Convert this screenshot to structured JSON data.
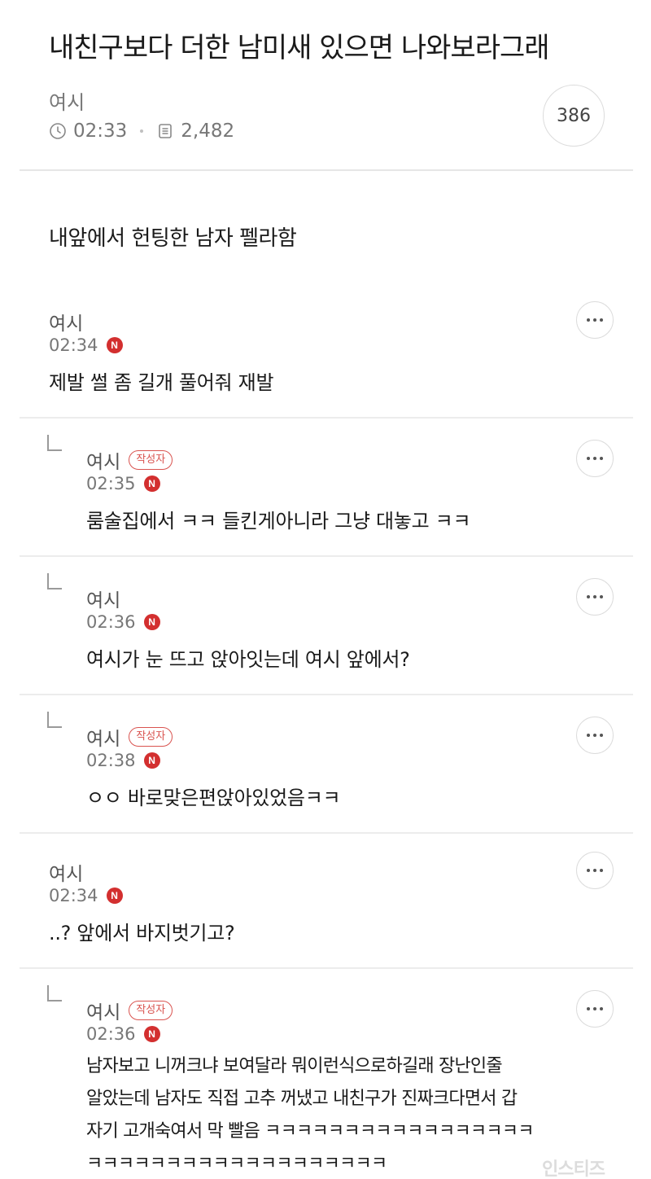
{
  "post": {
    "title": "내친구보다 더한 남미새 있으면 나와보라그래",
    "author": "여시",
    "time": "02:33",
    "views": "2,482",
    "reply_count": "386",
    "body": "내앞에서 헌팅한 남자 펠라함"
  },
  "badges": {
    "new": "N",
    "writer": "작성자"
  },
  "comments": [
    {
      "author": "여시",
      "time": "02:34",
      "text": "제발 썰 좀 길개 풀어줘 재발",
      "is_reply": false,
      "is_writer": false
    },
    {
      "author": "여시",
      "time": "02:35",
      "text": "룸술집에서 ㅋㅋ 들킨게아니라 그냥 대놓고 ㅋㅋ",
      "is_reply": true,
      "is_writer": true
    },
    {
      "author": "여시",
      "time": "02:36",
      "text": "여시가 눈 뜨고 앉아잇는데 여시 앞에서?",
      "is_reply": true,
      "is_writer": false
    },
    {
      "author": "여시",
      "time": "02:38",
      "text": "ㅇㅇ 바로맞은편앉아있었음ㅋㅋ",
      "is_reply": true,
      "is_writer": true
    },
    {
      "author": "여시",
      "time": "02:34",
      "text": "..? 앞에서 바지벗기고?",
      "is_reply": false,
      "is_writer": false
    },
    {
      "author": "여시",
      "time": "02:36",
      "text_lines": [
        "남자보고 니꺼크냐 보여달라 뭐이런식으로하길래 장난인줄",
        "알았는데 남자도 직접 고추 꺼냈고 내친구가 진짜크다면서 갑",
        "자기 고개숙여서 막 빨음 ㅋㅋㅋㅋㅋㅋㅋㅋㅋㅋㅋㅋㅋㅋㅋㅋㅋ",
        "ㅋㅋㅋㅋㅋㅋㅋㅋㅋㅋㅋㅋㅋㅋㅋㅋㅋㅋㅋ"
      ],
      "is_reply": true,
      "is_writer": true
    }
  ],
  "watermark": "인스티즈",
  "icons": {
    "clock": "clock-icon",
    "views": "document-icon",
    "more": "more-horizontal-icon",
    "reply": "reply-arrow-icon"
  },
  "colors": {
    "new_badge": "#d32f2f",
    "writer_badge": "#d9534f"
  }
}
